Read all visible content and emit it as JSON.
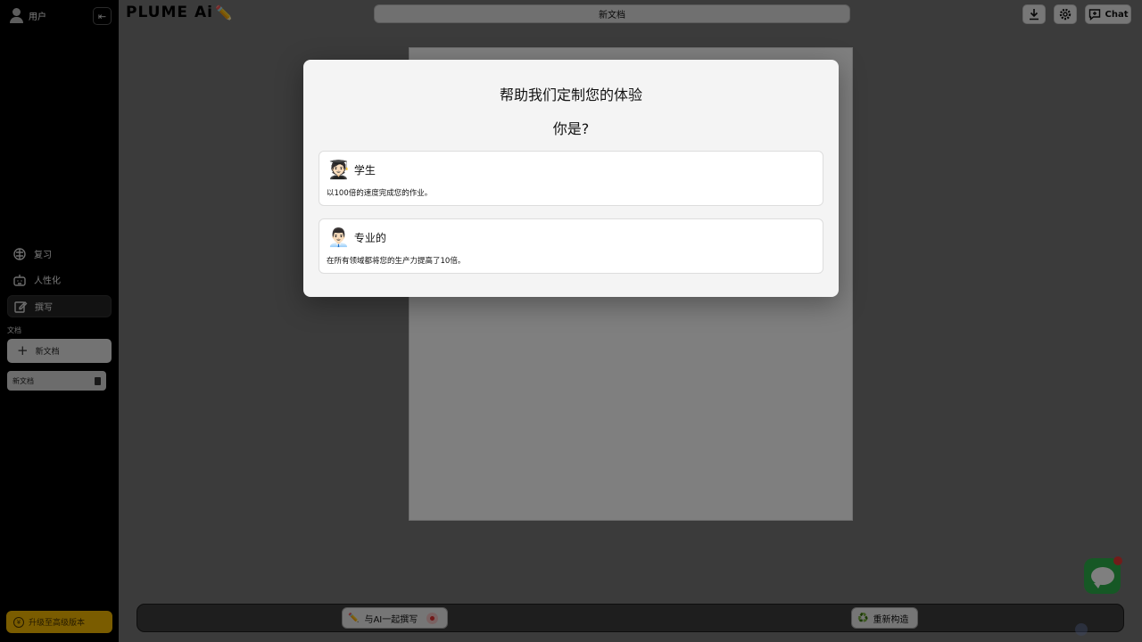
{
  "sidebar": {
    "user_label": "用户",
    "nav": [
      {
        "label": "复习",
        "icon": "brain-icon"
      },
      {
        "label": "人性化",
        "icon": "robot-icon"
      },
      {
        "label": "撰写",
        "icon": "edit-icon"
      }
    ],
    "docs_label": "文档",
    "new_doc_label": "新文档",
    "doc_items": [
      {
        "title": "新文档"
      }
    ],
    "upgrade_label": "升级至高级版本"
  },
  "header": {
    "logo": "PLUME Ai",
    "doc_title": "新文档",
    "chat_label": "Chat"
  },
  "bottom_bar": {
    "write_with_ai_label": "与AI一起撰写",
    "restructure_label": "重新构造"
  },
  "modal": {
    "title": "帮助我们定制您的体验",
    "question": "你是?",
    "options": [
      {
        "emoji": "🧑🏻‍🎓",
        "title": "学生",
        "description": "以100倍的速度完成您的作业。"
      },
      {
        "emoji": "👨🏻‍💼",
        "title": "专业的",
        "description": "在所有领域都将您的生产力提高了10倍。"
      }
    ]
  },
  "colors": {
    "sidebar_bg": "#000000",
    "upgrade_accent": "#f5b800",
    "chat_fab": "#2db14a",
    "record_dot": "#e03030"
  }
}
